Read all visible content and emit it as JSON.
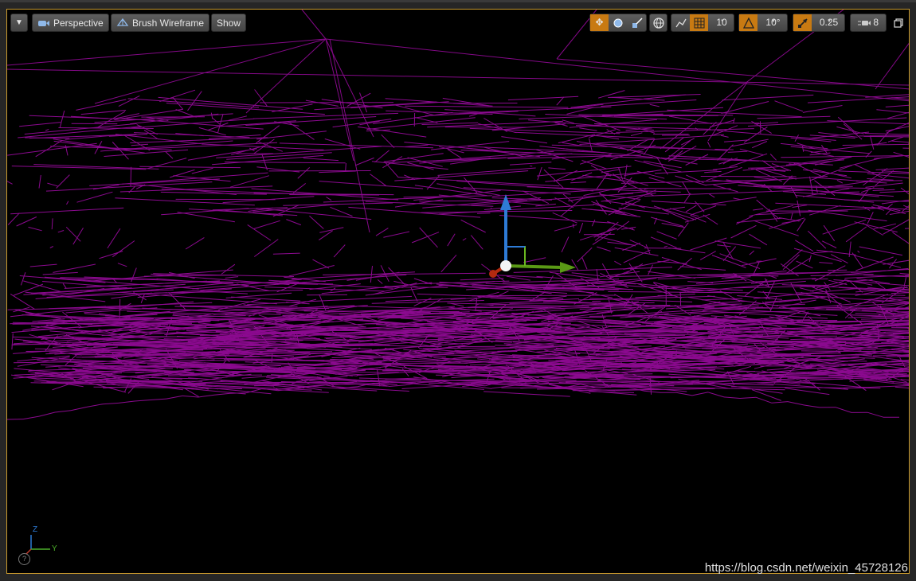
{
  "toolbar": {
    "view_mode_label": "Perspective",
    "render_mode_label": "Brush Wireframe",
    "show_label": "Show",
    "grid_snap_value": "10",
    "rotation_snap_value": "10°",
    "scale_snap_value": "0.25",
    "camera_speed_value": "8"
  },
  "axis_indicator": {
    "z": "Z",
    "y": "Y"
  },
  "help_label": "?",
  "watermark": "https://blog.csdn.net/weixin_45728126",
  "colors": {
    "wireframe": "#8b0a8f",
    "accent": "#c87a12",
    "border": "#c99a2e"
  }
}
